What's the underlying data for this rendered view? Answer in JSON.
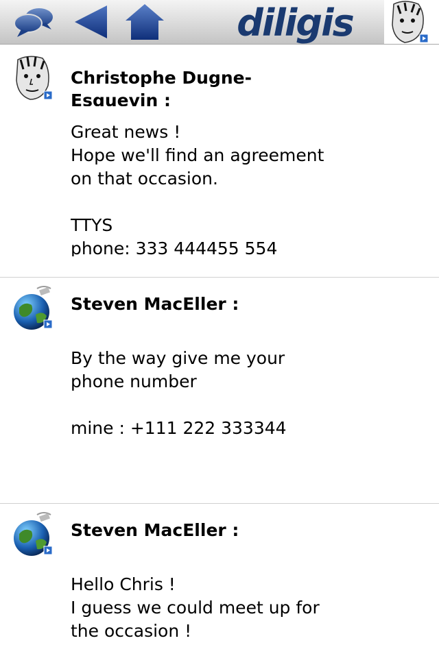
{
  "toolbar": {
    "chat_icon": "speech-bubbles-icon",
    "back_icon": "back-arrow-icon",
    "home_icon": "home-icon",
    "logo_text": "diligis",
    "brand_color": "#1a3a70"
  },
  "messages": [
    {
      "sender": "Christophe Dugne-Esquevin :",
      "avatar": "person-sketch-icon",
      "body": "Great news !\nHope we'll find an agreement\non that occasion.\n\nTTYS\nphone: 333 444455 554"
    },
    {
      "sender": "Steven MacEller :",
      "avatar": "globe-icon",
      "body": "By the way give me your\nphone number\n\nmine : +111 222 333344"
    },
    {
      "sender": "Steven MacEller :",
      "avatar": "globe-icon",
      "body": "Hello Chris !\nI guess we could meet up for\nthe occasion !"
    }
  ]
}
